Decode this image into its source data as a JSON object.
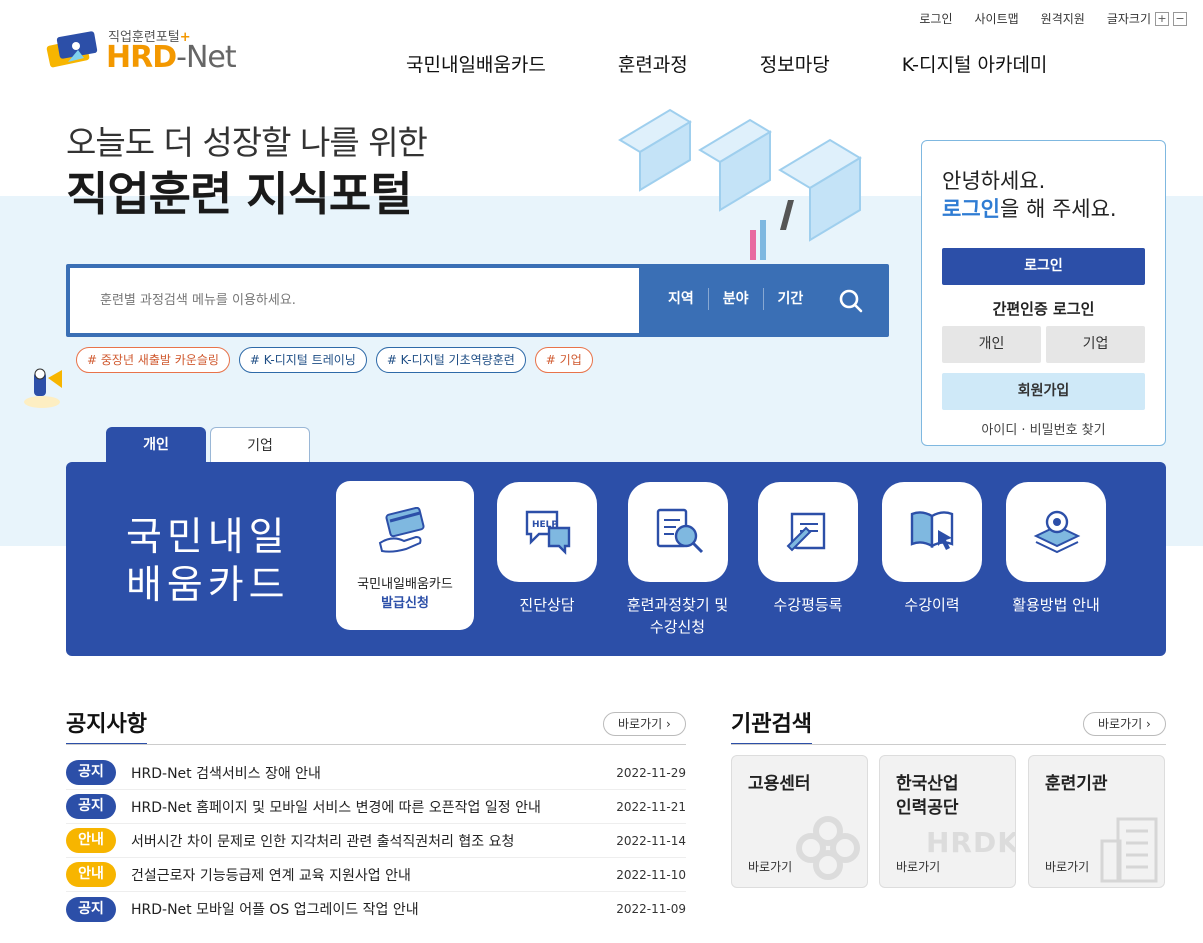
{
  "utility": {
    "login": "로그인",
    "sitemap": "사이트맵",
    "remote": "원격지원",
    "font_size": "글자크기",
    "plus": "+",
    "minus": "−"
  },
  "logo": {
    "sub": "직업훈련포털",
    "name_a": "HRD",
    "name_b": "-Net"
  },
  "gnb": [
    "국민내일배움카드",
    "훈련과정",
    "정보마당",
    "K-디지털 아카데미"
  ],
  "hero": {
    "sub": "오늘도 더 성장할 나를 위한",
    "title": "직업훈련 지식포털"
  },
  "search": {
    "placeholder": "훈련별 과정검색 메뉴를 이용하세요.",
    "filters": [
      "지역",
      "분야",
      "기간"
    ]
  },
  "tags": [
    "# 중장년 새출발 카운슬링",
    "# K-디지털 트레이닝",
    "# K-디지털 기초역량훈련",
    "# 기업"
  ],
  "login_box": {
    "greet1": "안녕하세요.",
    "greet_hl": "로그인",
    "greet2": "을 해 주세요.",
    "login_btn": "로그인",
    "easy": "간편인증 로그인",
    "personal": "개인",
    "company": "기업",
    "join": "회원가입",
    "find": "아이디 · 비밀번호 찾기"
  },
  "tabs": [
    "개인",
    "기업"
  ],
  "panel": {
    "title1": "국민내일",
    "title2": "배움카드",
    "big_label1": "국민내일배움카드",
    "big_label2": "발급신청",
    "services": [
      "진단상담",
      "훈련과정찾기 및",
      "수강평등록",
      "수강이력",
      "활용방법 안내"
    ],
    "service2_line2": "수강신청"
  },
  "notices": {
    "title": "공지사항",
    "more": "바로가기",
    "rows": [
      {
        "badge": "공지",
        "title": "HRD-Net 검색서비스 장애 안내",
        "date": "2022-11-29"
      },
      {
        "badge": "공지",
        "title": "HRD-Net 홈페이지 및 모바일 서비스 변경에 따른 오픈작업 일정 안내",
        "date": "2022-11-21"
      },
      {
        "badge": "안내",
        "title": "서버시간 차이 문제로 인한 지각처리 관련 출석직권처리 협조 요청",
        "date": "2022-11-14"
      },
      {
        "badge": "안내",
        "title": "건설근로자 기능등급제 연계 교육 지원사업 안내",
        "date": "2022-11-10"
      },
      {
        "badge": "공지",
        "title": "HRD-Net 모바일 어플 OS 업그레이드 작업 안내",
        "date": "2022-11-09"
      }
    ]
  },
  "institutions": {
    "title": "기관검색",
    "more": "바로가기",
    "cards": [
      {
        "name1": "고용센터",
        "name2": "",
        "go": "바로가기"
      },
      {
        "name1": "한국산업",
        "name2": "인력공단",
        "go": "바로가기",
        "watermark": "HRDK"
      },
      {
        "name1": "훈련기관",
        "name2": "",
        "go": "바로가기"
      }
    ]
  },
  "colors": {
    "primary": "#2c4fa8",
    "search": "#3a6fb5",
    "accent": "#f39800",
    "notice_yellow": "#f7b500"
  }
}
